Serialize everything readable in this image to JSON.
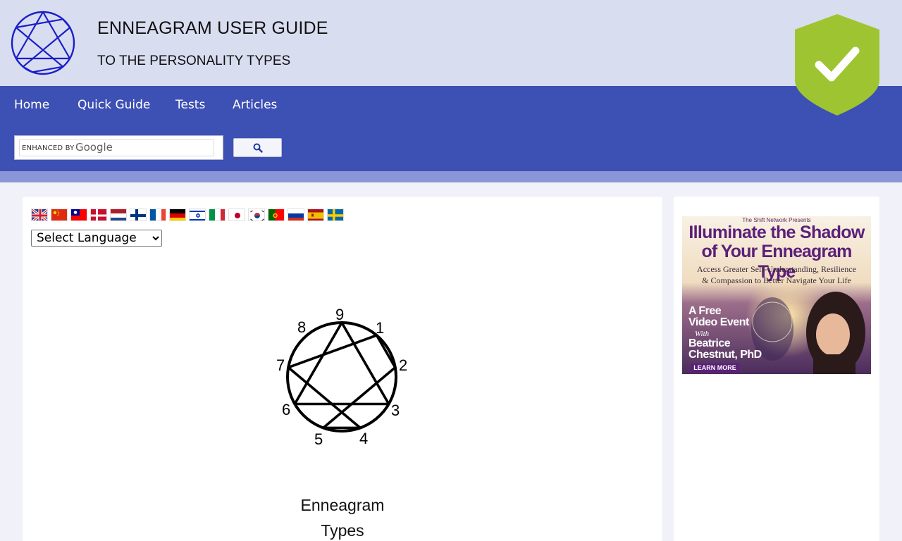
{
  "header": {
    "title": "ENNEAGRAM USER GUIDE",
    "subtitle": "TO THE PERSONALITY TYPES"
  },
  "nav": {
    "items": [
      {
        "label": "Home"
      },
      {
        "label": "Quick Guide"
      },
      {
        "label": "Tests"
      },
      {
        "label": "Articles"
      }
    ]
  },
  "search": {
    "enhanced_by": "ENHANCED BY",
    "provider": "Google"
  },
  "language": {
    "flags": [
      "uk-flag",
      "china-flag",
      "taiwan-flag",
      "denmark-flag",
      "netherlands-flag",
      "finland-flag",
      "france-flag",
      "germany-flag",
      "israel-flag",
      "italy-flag",
      "japan-flag",
      "korea-flag",
      "portugal-flag",
      "russia-flag",
      "spain-flag",
      "sweden-flag"
    ],
    "select_value": "Select Language"
  },
  "figure": {
    "numbers": [
      "9",
      "1",
      "2",
      "3",
      "4",
      "5",
      "6",
      "7",
      "8"
    ],
    "caption_line1": "Enneagram",
    "caption_line2": "Types"
  },
  "ad": {
    "presenter": "The Shift Network Presents",
    "title_line1": "Illuminate the Shadow",
    "title_line2": "of Your Enneagram Type",
    "subtitle_line1": "Access Greater Self-Understanding, Resilience",
    "subtitle_line2": "& Compassion to Better Navigate Your Life",
    "event_line1": "A Free",
    "event_line2": "Video Event",
    "with": "With",
    "name_line1": "Beatrice",
    "name_line2": "Chestnut, PhD",
    "cta": "LEARN MORE"
  },
  "colors": {
    "header_bg": "#d9ddf0",
    "nav_bg": "#3d50b4",
    "stripe": "#8a96d8",
    "shield": "#9ec531",
    "logo_stroke": "#1a1fc9"
  }
}
